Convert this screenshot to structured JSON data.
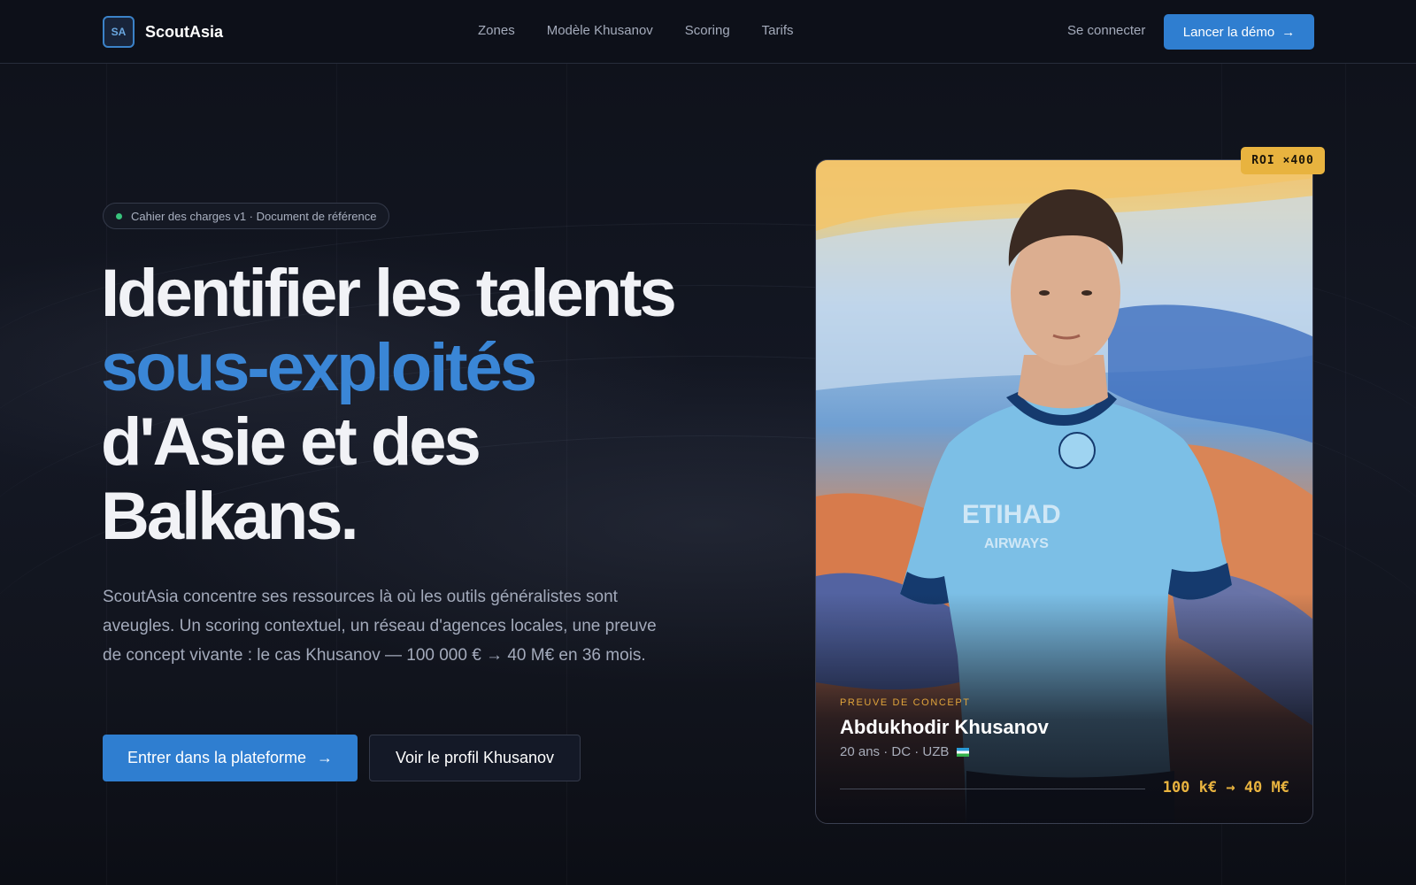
{
  "brand": {
    "logo_initials": "SA",
    "name": "ScoutAsia"
  },
  "nav": {
    "items": [
      {
        "label": "Zones"
      },
      {
        "label": "Modèle Khusanov"
      },
      {
        "label": "Scoring"
      },
      {
        "label": "Tarifs"
      }
    ]
  },
  "header": {
    "signin_label": "Se connecter",
    "demo_label": "Lancer la démo",
    "demo_icon": "arrow-right-icon"
  },
  "hero": {
    "pill_text": "Cahier des charges v1 · Document de référence",
    "title_line1": "Identifier les talents",
    "title_accent": "sous-exploités",
    "title_line3": "d'Asie et des",
    "title_line4": "Balkans.",
    "lead": "ScoutAsia concentre ses ressources là où les outils généralistes sont aveugles. Un scoring contextuel, un réseau d'agences locales, une preuve de concept vivante : le cas Khusanov — 100 000 € → 40 M€ en 36 mois.",
    "primary_cta": "Entrer dans la plateforme",
    "secondary_cta": "Voir le profil Khusanov"
  },
  "player_card": {
    "badge": "ROI ×400",
    "eyebrow": "PREUVE DE CONCEPT",
    "name": "Abdukhodir Khusanov",
    "meta": "20 ans · DC · UZB",
    "value_range": "100 k€ → 40 M€"
  },
  "colors": {
    "accent": "#2f7ed0",
    "accent_text": "#3a86d6",
    "gold": "#e8b33f",
    "status_dot": "#38c37c",
    "background": "#0d1019"
  }
}
